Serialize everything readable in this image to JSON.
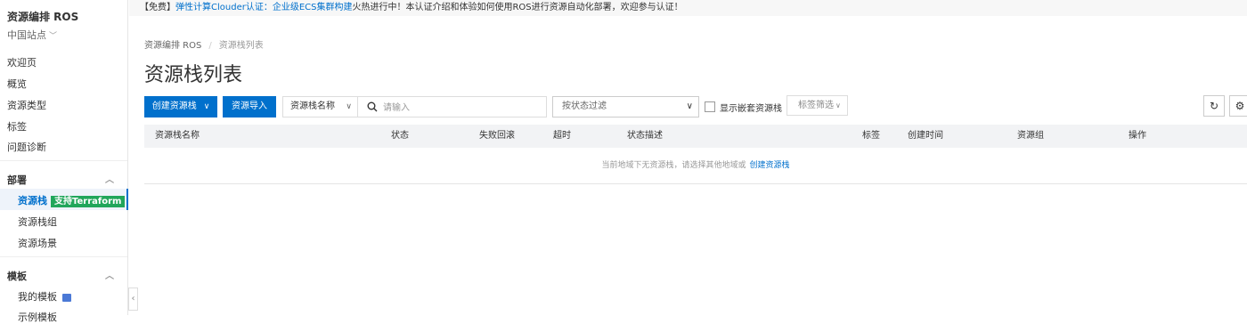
{
  "banner": {
    "prefix": "【免费】",
    "link": "弹性计算Clouder认证：企业级ECS集群构建",
    "suffix": "火热进行中！本认证介绍和体验如何使用ROS进行资源自动化部署，欢迎参与认证！"
  },
  "sidebar": {
    "title": "资源编排 ROS",
    "region": "中国站点",
    "items": [
      "欢迎页",
      "概览",
      "资源类型",
      "标签",
      "问题诊断"
    ],
    "deploy_group": {
      "label": "部署",
      "items": [
        {
          "label": "资源栈",
          "badge": "支持Terraform"
        },
        {
          "label": "资源栈组"
        },
        {
          "label": "资源场景"
        }
      ]
    },
    "template_group": {
      "label": "模板",
      "items": [
        {
          "label": "我的模板"
        },
        {
          "label": "示例模板"
        }
      ]
    }
  },
  "breadcrumb": {
    "root": "资源编排 ROS",
    "current": "资源栈列表"
  },
  "page_title": "资源栈列表",
  "toolbar": {
    "create_label": "创建资源栈",
    "import_label": "资源导入",
    "filter_field": "资源栈名称",
    "search_placeholder": "请输入",
    "status_filter": "按状态过滤",
    "show_nested": "显示嵌套资源栈",
    "tag_filter": "标签筛选"
  },
  "table": {
    "columns": [
      "资源栈名称",
      "状态",
      "失败回滚",
      "超时",
      "状态描述",
      "标签",
      "创建时间",
      "资源组",
      "操作"
    ],
    "empty_text": "当前地域下无资源栈，请选择其他地域或",
    "empty_link": "创建资源栈"
  },
  "icons": {
    "refresh": "refresh-icon",
    "settings": "gear-icon",
    "search": "search-icon"
  },
  "colors": {
    "primary": "#0070cc",
    "badge": "#21a65b"
  }
}
